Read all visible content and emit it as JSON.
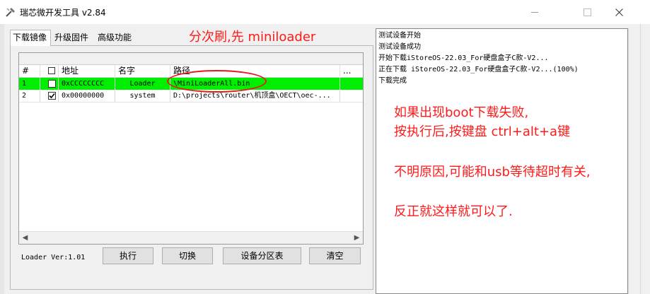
{
  "window": {
    "title": "瑞芯微开发工具 v2.84"
  },
  "tabs": [
    {
      "label": "下载镜像"
    },
    {
      "label": "升级固件"
    },
    {
      "label": "高级功能"
    }
  ],
  "grid": {
    "columns": [
      "#",
      "地址",
      "名字",
      "路径",
      "..."
    ],
    "rows": [
      {
        "num": "1",
        "checked": false,
        "address": "0xCCCCCCCC",
        "name": "Loader",
        "path": "\\MiniLoaderAll.bin",
        "extra": ""
      },
      {
        "num": "2",
        "checked": true,
        "address": "0x00000000",
        "name": "system",
        "path": "D:\\projects\\router\\机顶盒\\OECT\\oec-...",
        "extra": ""
      }
    ],
    "highlight_color": "#00ee00"
  },
  "bottom": {
    "loader_version": "Loader Ver:1.01",
    "buttons": {
      "execute": "执行",
      "switch": "切换",
      "partition_table": "设备分区表",
      "clear": "清空"
    }
  },
  "log": {
    "lines": [
      "测试设备开始",
      "测试设备成功",
      "开始下载iStoreOS-22.03_For硬盘盒子C款-V2...",
      "正在下载 iStoreOS-22.03_For硬盘盒子C款-V2...(100%)",
      "下载完成"
    ]
  },
  "annotations": {
    "top": "分次刷,先 miniloader",
    "right_1": "如果出现boot下载失败,",
    "right_2": "按执行后,按键盘 ctrl+alt+a键",
    "right_3": "不明原因,可能和usb等待超时有关,",
    "right_4": "反正就这样就可以了.",
    "color": "#ff1a1a"
  }
}
